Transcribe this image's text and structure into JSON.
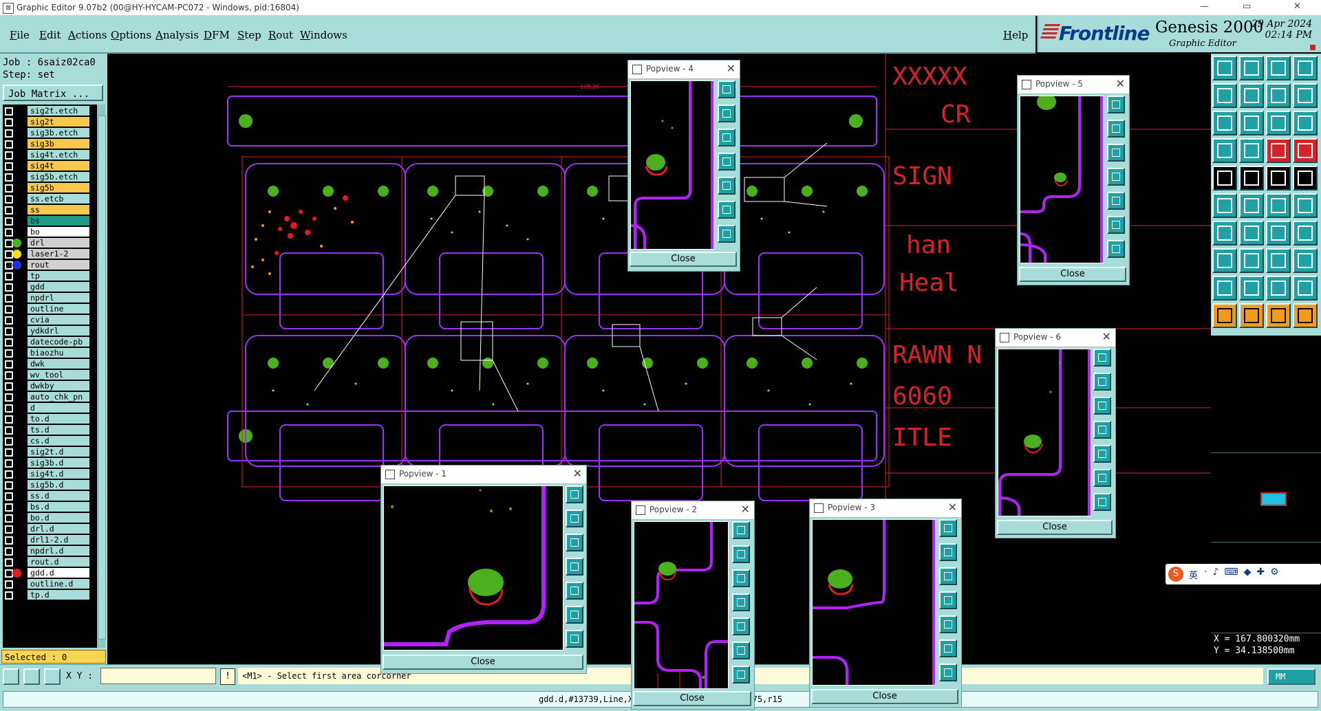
{
  "window": {
    "title": "Graphic Editor 9.07b2 (00@HY-HYCAM-PC072 - Windows, pid:16804)",
    "controls": [
      "—",
      "▭",
      "✕"
    ]
  },
  "menu": {
    "items": [
      "File",
      "Edit",
      "Actions",
      "Options",
      "Analysis",
      "DFM",
      "Step",
      "Rout",
      "Windows"
    ],
    "help": "Help"
  },
  "brand": {
    "logo": "Frontline",
    "product": "Genesis 2000",
    "subtitle": "Graphic Editor",
    "date": "29 Apr 2024",
    "time": "02:14 PM"
  },
  "job": {
    "job_label": "Job : 6saiz02ca0",
    "step_label": "Step: set",
    "job_matrix": "Job Matrix ..."
  },
  "layers": [
    {
      "name": "sig2t.etch",
      "bg": "#a8dcd8",
      "dot": ""
    },
    {
      "name": "sig2t",
      "bg": "#f7c84a",
      "dot": ""
    },
    {
      "name": "sig3b.etch",
      "bg": "#a8dcd8",
      "dot": ""
    },
    {
      "name": "sig3b",
      "bg": "#f7c84a",
      "dot": ""
    },
    {
      "name": "sig4t.etch",
      "bg": "#a8dcd8",
      "dot": ""
    },
    {
      "name": "sig4t",
      "bg": "#f7c84a",
      "dot": ""
    },
    {
      "name": "sig5b.etch",
      "bg": "#a8dcd8",
      "dot": ""
    },
    {
      "name": "sig5b",
      "bg": "#f7c84a",
      "dot": ""
    },
    {
      "name": "ss.etcb",
      "bg": "#a8dcd8",
      "dot": ""
    },
    {
      "name": "ss",
      "bg": "#f7c84a",
      "dot": ""
    },
    {
      "name": "bs",
      "bg": "#1f9b8a",
      "dot": ""
    },
    {
      "name": "bo",
      "bg": "#ffffff",
      "dot": ""
    },
    {
      "name": "drl",
      "bg": "#d0d0d0",
      "dot": "#4caf1e"
    },
    {
      "name": "laser1-2",
      "bg": "#d0d0d0",
      "dot": "#f2e01a"
    },
    {
      "name": "rout",
      "bg": "#d0d0d0",
      "dot": "#2030e0"
    },
    {
      "name": "tp",
      "bg": "#a8dcd8",
      "dot": ""
    },
    {
      "name": "gdd",
      "bg": "#a8dcd8",
      "dot": ""
    },
    {
      "name": "npdrl",
      "bg": "#a8dcd8",
      "dot": ""
    },
    {
      "name": "outline",
      "bg": "#a8dcd8",
      "dot": ""
    },
    {
      "name": "cvia",
      "bg": "#a8dcd8",
      "dot": ""
    },
    {
      "name": "ydkdrl",
      "bg": "#a8dcd8",
      "dot": ""
    },
    {
      "name": "datecode-pb",
      "bg": "#a8dcd8",
      "dot": ""
    },
    {
      "name": "biaozhu",
      "bg": "#a8dcd8",
      "dot": ""
    },
    {
      "name": "dwk",
      "bg": "#a8dcd8",
      "dot": ""
    },
    {
      "name": "wv_tool",
      "bg": "#a8dcd8",
      "dot": ""
    },
    {
      "name": "dwkby",
      "bg": "#a8dcd8",
      "dot": ""
    },
    {
      "name": "auto_chk_pn",
      "bg": "#a8dcd8",
      "dot": ""
    },
    {
      "name": "d",
      "bg": "#a8dcd8",
      "dot": ""
    },
    {
      "name": "to.d",
      "bg": "#a8dcd8",
      "dot": ""
    },
    {
      "name": "ts.d",
      "bg": "#a8dcd8",
      "dot": ""
    },
    {
      "name": "cs.d",
      "bg": "#a8dcd8",
      "dot": ""
    },
    {
      "name": "sig2t.d",
      "bg": "#a8dcd8",
      "dot": ""
    },
    {
      "name": "sig3b.d",
      "bg": "#a8dcd8",
      "dot": ""
    },
    {
      "name": "sig4t.d",
      "bg": "#a8dcd8",
      "dot": ""
    },
    {
      "name": "sig5b.d",
      "bg": "#a8dcd8",
      "dot": ""
    },
    {
      "name": "ss.d",
      "bg": "#a8dcd8",
      "dot": ""
    },
    {
      "name": "bs.d",
      "bg": "#a8dcd8",
      "dot": ""
    },
    {
      "name": "bo.d",
      "bg": "#a8dcd8",
      "dot": ""
    },
    {
      "name": "drl.d",
      "bg": "#a8dcd8",
      "dot": ""
    },
    {
      "name": "drl1-2.d",
      "bg": "#a8dcd8",
      "dot": ""
    },
    {
      "name": "npdrl.d",
      "bg": "#a8dcd8",
      "dot": ""
    },
    {
      "name": "rout.d",
      "bg": "#a8dcd8",
      "dot": ""
    },
    {
      "name": "gdd.d",
      "bg": "#ffffff",
      "dot": "#e21b1b"
    },
    {
      "name": "outline.d",
      "bg": "#a8dcd8",
      "dot": ""
    },
    {
      "name": "tp.d",
      "bg": "#a8dcd8",
      "dot": ""
    }
  ],
  "selected": "Selected : 0",
  "canvas": {
    "dimension": "165.25",
    "title_block": [
      "XXXXX",
      "CR",
      "SIGN",
      "han",
      "Heal",
      "RAWN N",
      "6060",
      "ITLE"
    ]
  },
  "popviews": [
    {
      "title": "Popview - 1",
      "close": "Close"
    },
    {
      "title": "Popview - 2",
      "close": "Close"
    },
    {
      "title": "Popview - 3",
      "close": "Close"
    },
    {
      "title": "Popview - 4",
      "close": "Close"
    },
    {
      "title": "Popview - 5",
      "close": "Close"
    },
    {
      "title": "Popview - 6",
      "close": "Close"
    }
  ],
  "coords": {
    "x": "X = 167.800320mm",
    "y": "Y = 34.138500mm"
  },
  "bottom": {
    "xy_label": "X Y :",
    "xy_value": "",
    "bang": "!",
    "prompt": "<M1> - Select first area corcorner",
    "units": "MM"
  },
  "status": "gdd.d,#13739,Line,XS=79.4301175,YS=69.9597275,r15"
}
